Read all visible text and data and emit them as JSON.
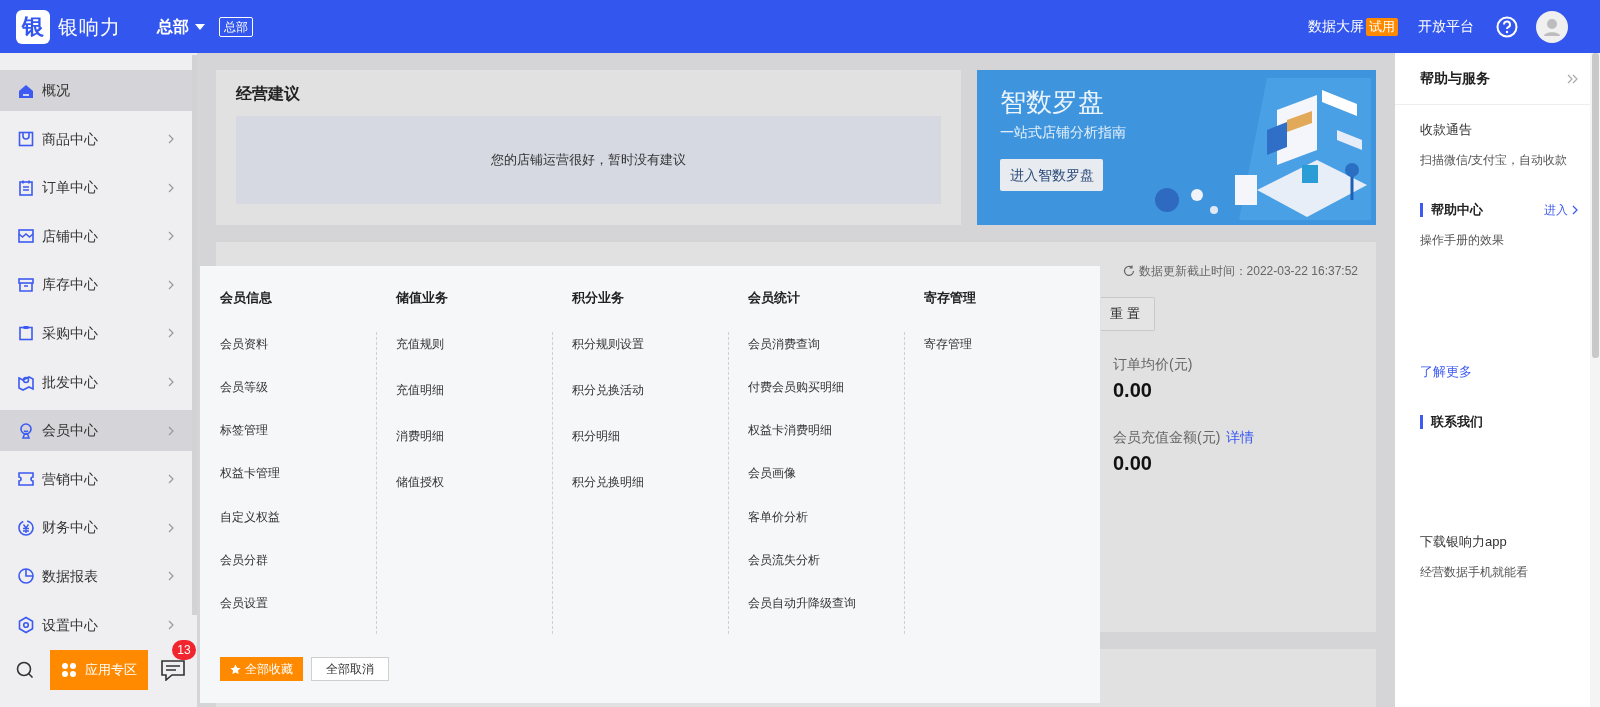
{
  "header": {
    "logo_mark": "银",
    "brand": "银响力",
    "org": "总部",
    "org_tag": "总部",
    "links": [
      {
        "label": "数据大屏",
        "badge": "试用"
      },
      {
        "label": "开放平台"
      }
    ]
  },
  "sidebar": {
    "items": [
      {
        "label": "概况",
        "highlighted": true,
        "has_arrow": false
      },
      {
        "label": "商品中心",
        "highlighted": false,
        "has_arrow": true
      },
      {
        "label": "订单中心",
        "highlighted": false,
        "has_arrow": true
      },
      {
        "label": "店铺中心",
        "highlighted": false,
        "has_arrow": true
      },
      {
        "label": "库存中心",
        "highlighted": false,
        "has_arrow": true
      },
      {
        "label": "采购中心",
        "highlighted": false,
        "has_arrow": true
      },
      {
        "label": "批发中心",
        "highlighted": false,
        "has_arrow": true
      },
      {
        "label": "会员中心",
        "highlighted": true,
        "has_arrow": true
      },
      {
        "label": "营销中心",
        "highlighted": false,
        "has_arrow": true
      },
      {
        "label": "财务中心",
        "highlighted": false,
        "has_arrow": true
      },
      {
        "label": "数据报表",
        "highlighted": false,
        "has_arrow": true
      },
      {
        "label": "设置中心",
        "highlighted": false,
        "has_arrow": true
      }
    ],
    "footer": {
      "apps_button": "应用专区",
      "message_count": "13"
    }
  },
  "suggestion_card": {
    "title": "经营建议",
    "message": "您的店铺运营很好，暂时没有建议"
  },
  "banner": {
    "title": "智数罗盘",
    "subtitle": "一站式店铺分析指南",
    "button": "进入智数罗盘"
  },
  "overview_card": {
    "updated": "数据更新截止时间：2022-03-22 16:37:52",
    "reset_button": "重 置",
    "stats": [
      {
        "label": "订单均价(元)",
        "value": "0.00"
      },
      {
        "label": "会员充值金额(元)",
        "link": "详情",
        "value": "0.00"
      }
    ]
  },
  "dropdown": {
    "columns": [
      {
        "heading": "会员信息",
        "items": [
          "会员资料",
          "会员等级",
          "标签管理",
          "权益卡管理",
          "自定义权益",
          "会员分群",
          "会员设置"
        ]
      },
      {
        "heading": "储值业务",
        "items": [
          "充值规则",
          "充值明细",
          "消费明细",
          "储值授权"
        ]
      },
      {
        "heading": "积分业务",
        "items": [
          "积分规则设置",
          "积分兑换活动",
          "积分明细",
          "积分兑换明细"
        ]
      },
      {
        "heading": "会员统计",
        "items": [
          "会员消费查询",
          "付费会员购买明细",
          "权益卡消费明细",
          "会员画像",
          "客单价分析",
          "会员流失分析",
          "会员自动升降级查询"
        ]
      },
      {
        "heading": "寄存管理",
        "items": [
          "寄存管理"
        ]
      }
    ],
    "buttons": [
      {
        "label": "全部收藏",
        "kind": "primary"
      },
      {
        "label": "全部取消",
        "kind": "default"
      }
    ]
  },
  "help_panel": {
    "title": "帮助与服务",
    "groups": [
      {
        "kind": "plain",
        "title": "收款通告",
        "note": "扫描微信/支付宝，自动收款"
      },
      {
        "kind": "section",
        "title": "帮助中心",
        "action": "进入",
        "note": "操作手册的效果",
        "link": "了解更多"
      },
      {
        "kind": "section",
        "title": "联系我们"
      },
      {
        "kind": "plain",
        "title": "下载银响力app",
        "note": "经营数据手机就能看"
      }
    ]
  }
}
